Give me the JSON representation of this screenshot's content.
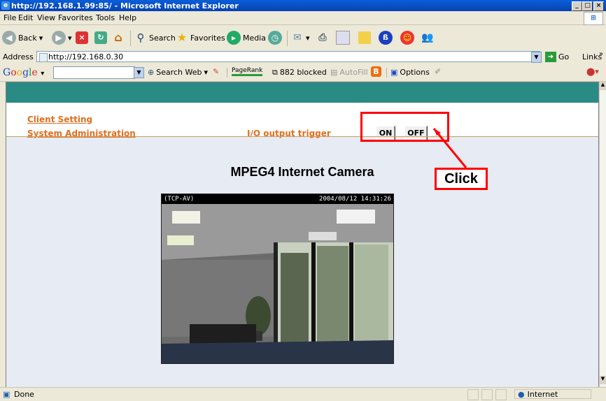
{
  "window": {
    "title": "http://192.168.1.99:85/ - Microsoft Internet Explorer",
    "controls": [
      "_",
      "□",
      "×"
    ]
  },
  "menu": {
    "items": [
      "File",
      "Edit",
      "View",
      "Favorites",
      "Tools",
      "Help"
    ]
  },
  "toolbar": {
    "back_label": "Back",
    "search_label": "Search",
    "favorites_label": "Favorites",
    "media_label": "Media"
  },
  "address": {
    "label": "Address",
    "url": "http://192.168.0.30",
    "go_label": "Go",
    "links_label": "Links"
  },
  "googlebar": {
    "logo": "Google",
    "search_web_label": "Search Web",
    "pagerank_label": "PageRank",
    "blocked_label": "882 blocked",
    "autofill_label": "AutoFill",
    "options_label": "Options"
  },
  "page": {
    "client_setting": "Client Setting",
    "system_admin": "System Administration",
    "io_label": "I/O output trigger",
    "on_label": "ON",
    "off_label": "OFF",
    "camera_title": "MPEG4 Internet Camera",
    "video_mode": "(TCP-AV)",
    "video_timestamp": "2004/08/12 14:31:26"
  },
  "annotation": {
    "click_label": "Click",
    "color": "#ff0000"
  },
  "status": {
    "text": "Done",
    "zone": "Internet"
  },
  "colors": {
    "accent_teal": "#2a8a84",
    "link_orange": "#e07020"
  }
}
